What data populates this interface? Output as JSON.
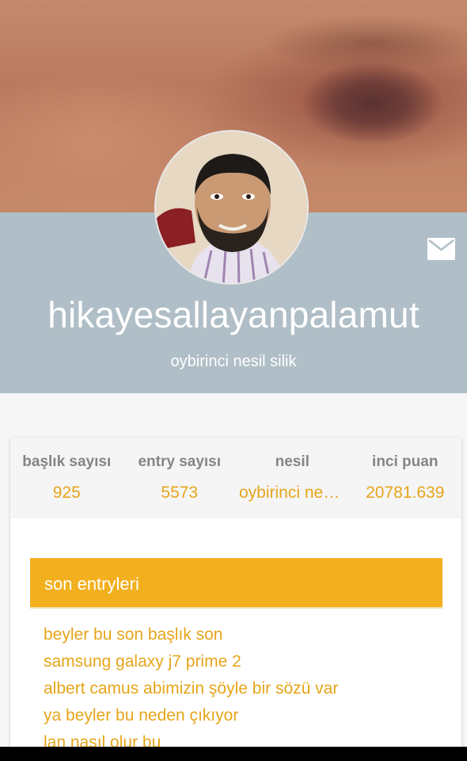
{
  "profile": {
    "username": "hikayesallayanpalamut",
    "generation": "oybirinci nesil silik"
  },
  "stats": [
    {
      "label": "başlık sayısı",
      "value": "925"
    },
    {
      "label": "entry sayısı",
      "value": "5573"
    },
    {
      "label": "nesil",
      "value": "oybirinci nesil silik"
    },
    {
      "label": "inci puan",
      "value": "20781.639"
    }
  ],
  "recent_entries": {
    "title": "son entryleri",
    "items": [
      "beyler bu son başlık son",
      "samsung galaxy j7 prime 2",
      "albert camus abimizin şöyle bir sözü var",
      "ya beyler bu neden çıkıyor",
      "lan nasıl olur bu"
    ]
  },
  "colors": {
    "accent": "#f2b01e",
    "accent_text": "#e6a51a",
    "header_bg": "#b0bec7",
    "stats_bg": "#f5f5f5"
  },
  "icons": {
    "mail": "envelope-icon"
  }
}
